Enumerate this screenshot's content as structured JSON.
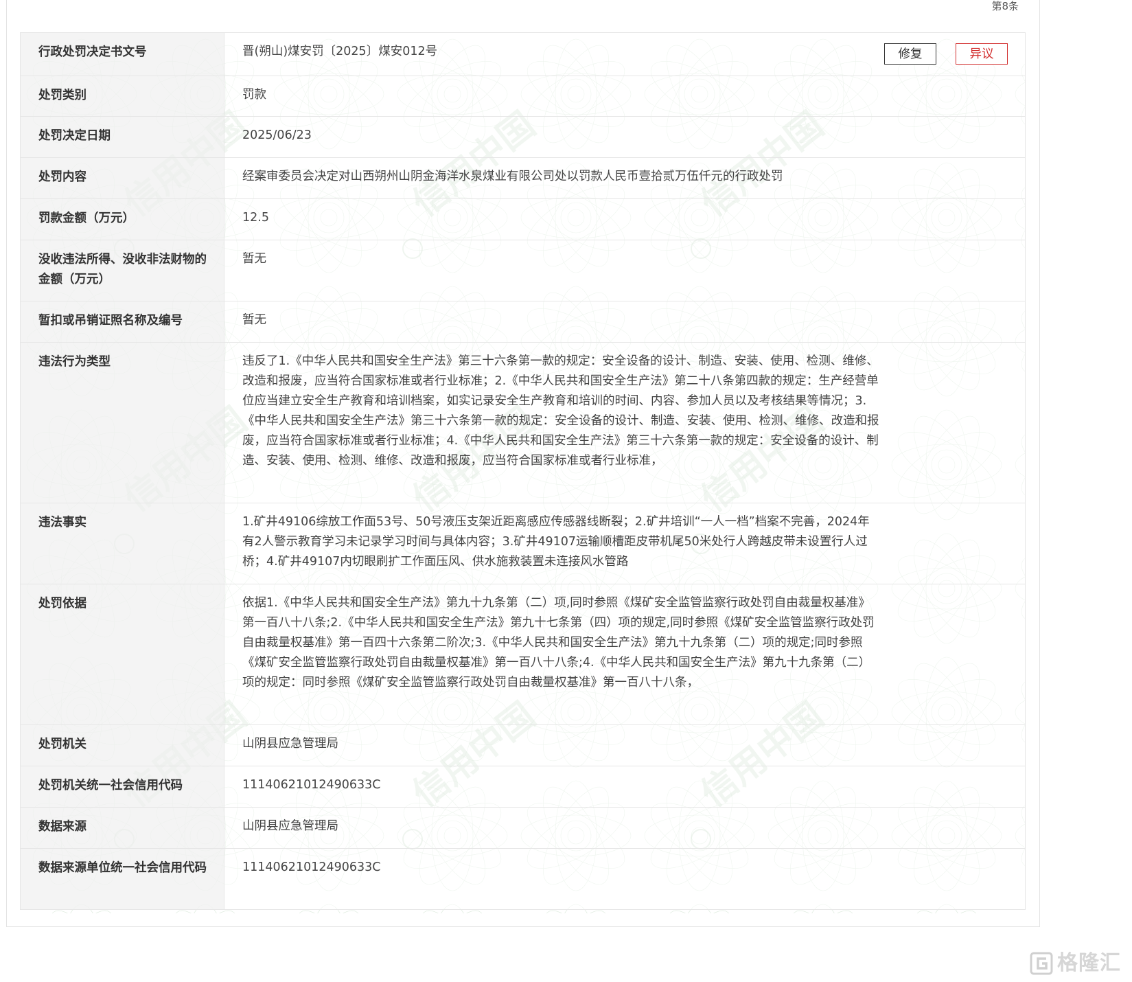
{
  "record_index": "第8条",
  "actions": {
    "fix_label": "修复",
    "dispute_label": "异议"
  },
  "watermark_text": "信用中国",
  "rows": [
    {
      "label": "行政处罚决定书文号",
      "value": "晋(朔山)煤安罚〔2025〕煤安012号"
    },
    {
      "label": "处罚类别",
      "value": "罚款"
    },
    {
      "label": "处罚决定日期",
      "value": "2025/06/23"
    },
    {
      "label": "处罚内容",
      "value": "经案审委员会决定对山西朔州山阴金海洋水泉煤业有限公司处以罚款人民币壹拾贰万伍仟元的行政处罚"
    },
    {
      "label": "罚款金额（万元）",
      "value": "12.5"
    },
    {
      "label": "没收违法所得、没收非法财物的金额（万元）",
      "value": "暂无"
    },
    {
      "label": "暂扣或吊销证照名称及编号",
      "value": "暂无"
    },
    {
      "label": "违法行为类型",
      "value": "违反了1.《中华人民共和国安全生产法》第三十六条第一款的规定：安全设备的设计、制造、安装、使用、检测、维修、改造和报废，应当符合国家标准或者行业标准；2.《中华人民共和国安全生产法》第二十八条第四款的规定：生产经营单位应当建立安全生产教育和培训档案，如实记录安全生产教育和培训的时间、内容、参加人员以及考核结果等情况；3.《中华人民共和国安全生产法》第三十六条第一款的规定：安全设备的设计、制造、安装、使用、检测、维修、改造和报废，应当符合国家标准或者行业标准；4.《中华人民共和国安全生产法》第三十六条第一款的规定：安全设备的设计、制造、安装、使用、检测、维修、改造和报废，应当符合国家标准或者行业标准，"
    },
    {
      "label": "违法事实",
      "value": "1.矿井49106综放工作面53号、50号液压支架近距离感应传感器线断裂；2.矿井培训“一人一档”档案不完善，2024年有2人警示教育学习未记录学习时间与具体内容；3.矿井49107运输顺槽距皮带机尾50米处行人跨越皮带未设置行人过桥；4.矿井49107内切眼刷扩工作面压风、供水施救装置未连接风水管路"
    },
    {
      "label": "处罚依据",
      "value": "依据1.《中华人民共和国安全生产法》第九十九条第（二）项,同时参照《煤矿安全监管监察行政处罚自由裁量权基准》第一百八十八条;2.《中华人民共和国安全生产法》第九十七条第（四）项的规定,同时参照《煤矿安全监管监察行政处罚自由裁量权基准》第一百四十六条第二阶次;3.《中华人民共和国安全生产法》第九十九条第（二）项的规定;同时参照《煤矿安全监管监察行政处罚自由裁量权基准》第一百八十八条;4.《中华人民共和国安全生产法》第九十九条第（二）项的规定：同时参照《煤矿安全监管监察行政处罚自由裁量权基准》第一百八十八条，"
    },
    {
      "label": "处罚机关",
      "value": "山阴县应急管理局"
    },
    {
      "label": "处罚机关统一社会信用代码",
      "value": "11140621012490633C"
    },
    {
      "label": "数据来源",
      "value": "山阴县应急管理局"
    },
    {
      "label": "数据来源单位统一社会信用代码",
      "value": "11140621012490633C"
    }
  ],
  "brand": {
    "text": "格隆汇",
    "logo_icon": "g-logo-icon"
  },
  "colors": {
    "label_bg": "#f2f2f2",
    "border": "#e6e6e6",
    "dispute": "#d22e2e",
    "watermark": "#9ec29e"
  }
}
